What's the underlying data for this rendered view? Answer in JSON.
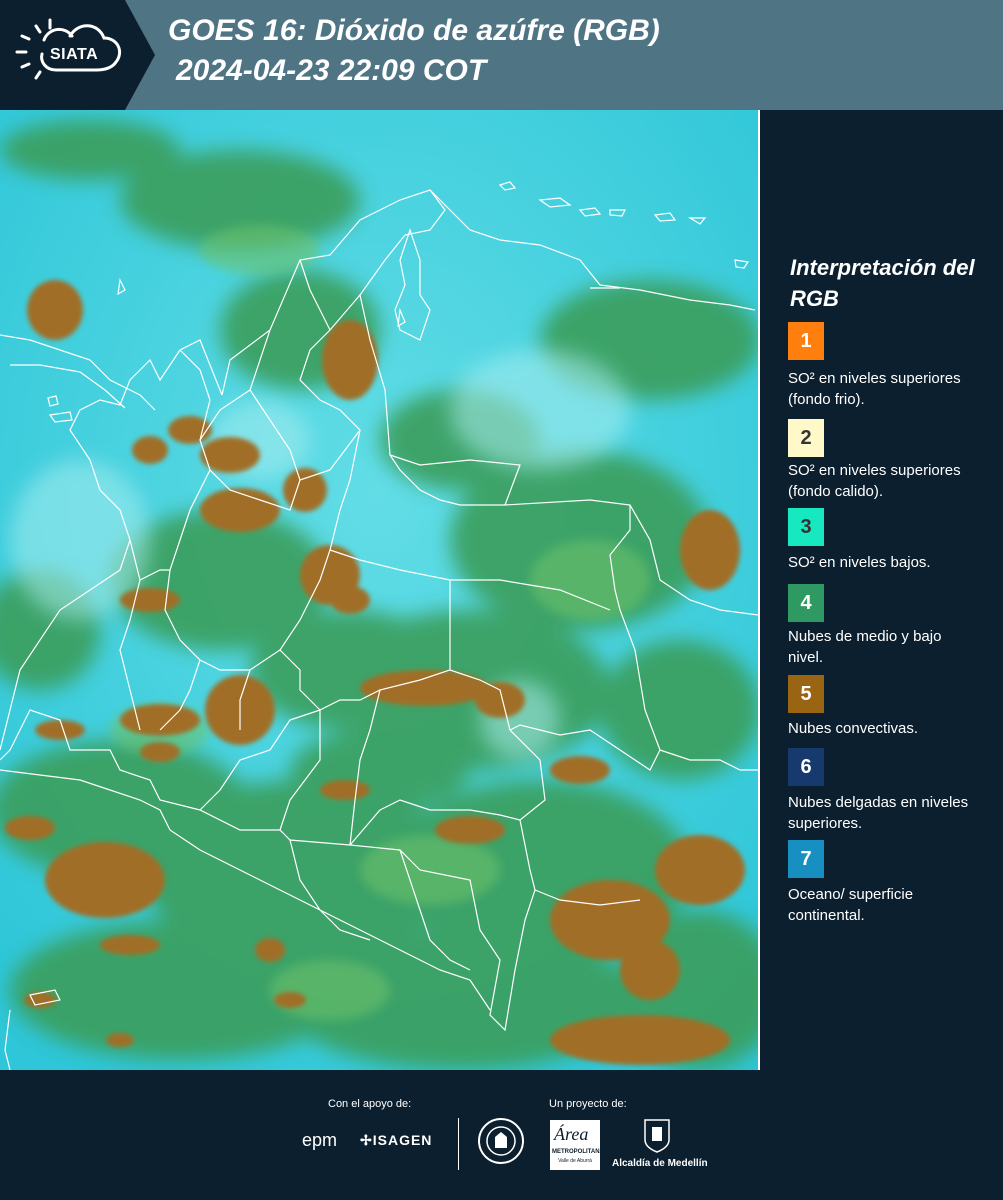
{
  "header": {
    "logo_text": "SIATA",
    "title_line1": "GOES 16: Dióxido de azúfre (RGB)",
    "title_line2": "2024-04-23 22:09 COT"
  },
  "legend": {
    "title": "Interpretación del RGB",
    "items": [
      {
        "number": "1",
        "color": "#ff7f0e",
        "label": "SO² en niveles superiores (fondo frio)."
      },
      {
        "number": "2",
        "color": "#fff8c8",
        "label": "SO² en niveles superiores (fondo calido)."
      },
      {
        "number": "3",
        "color": "#18e8c0",
        "label": "SO² en niveles bajos."
      },
      {
        "number": "4",
        "color": "#2e9a62",
        "label": "Nubes de medio y bajo nivel."
      },
      {
        "number": "5",
        "color": "#9a6512",
        "label": "Nubes convectivas."
      },
      {
        "number": "6",
        "color": "#173a6e",
        "label": "Nubes delgadas en niveles superiores."
      },
      {
        "number": "7",
        "color": "#178fc0",
        "label": "Oceano/ superficie continental."
      }
    ]
  },
  "footer": {
    "support_label": "Con el apoyo de:",
    "project_label": "Un proyecto de:",
    "sponsor_1": "epm",
    "sponsor_2": "ISAGEN",
    "partner_1": "METROPOLITANA",
    "partner_1_sub": "Valle de Aburrá",
    "partner_2": "Alcaldía de Medellín"
  },
  "colors": {
    "background": "#0c1f2e",
    "header": "#4f7585",
    "cyan": "#28c8d8",
    "green": "#3aa060",
    "brown": "#a06e28"
  }
}
